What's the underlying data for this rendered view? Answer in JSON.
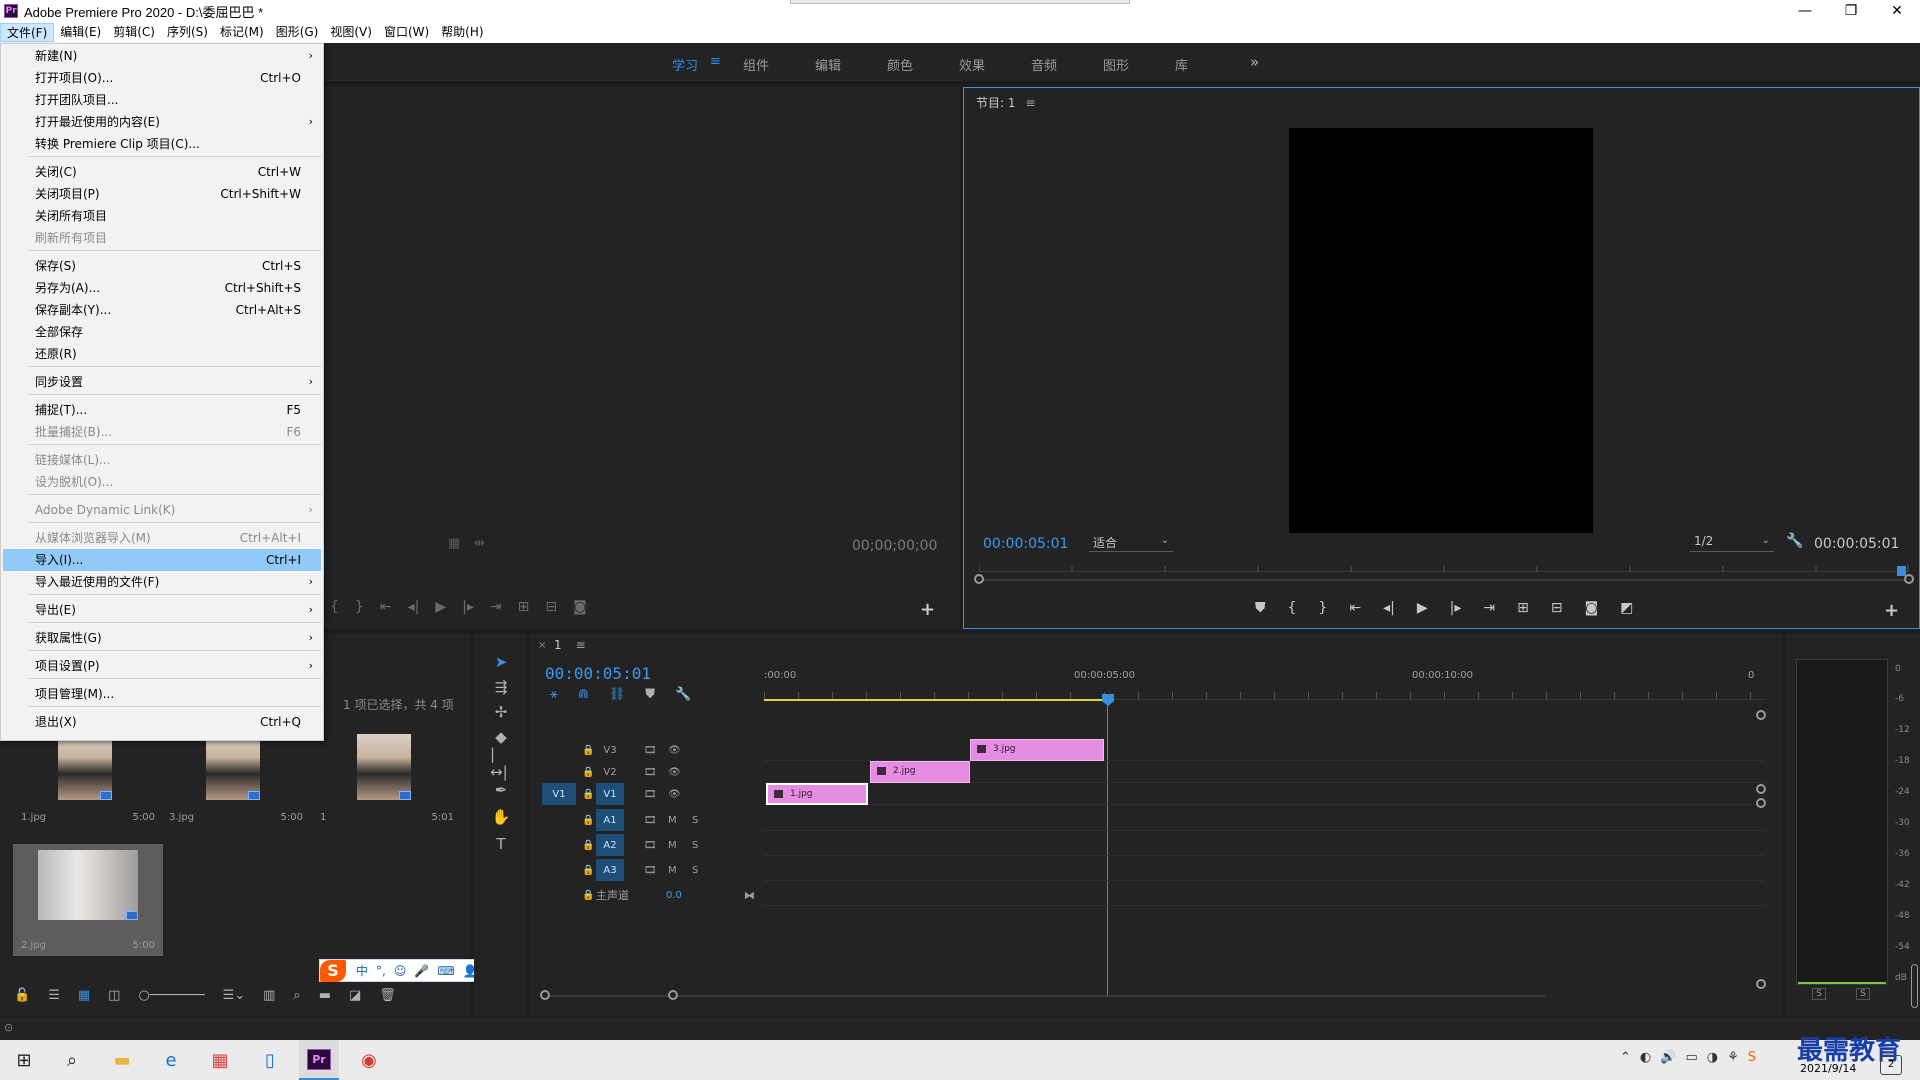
{
  "window": {
    "title": "Adobe Premiere Pro 2020 - D:\\委屈巴巴 *",
    "logo": "Pr",
    "controls": {
      "minimize": "—",
      "restore": "❐",
      "close": "✕"
    }
  },
  "menubar": [
    "文件(F)",
    "编辑(E)",
    "剪辑(C)",
    "序列(S)",
    "标记(M)",
    "图形(G)",
    "视图(V)",
    "窗口(W)",
    "帮助(H)"
  ],
  "workspaces": {
    "tabs": [
      "学习",
      "组件",
      "编辑",
      "颜色",
      "效果",
      "音频",
      "图形",
      "库"
    ],
    "active": "学习",
    "menu_icon": "≡",
    "more_icon": "»"
  },
  "file_menu": {
    "items": [
      {
        "label": "新建(N)",
        "shortcut": "",
        "submenu": true,
        "disabled": false
      },
      {
        "label": "打开项目(O)...",
        "shortcut": "Ctrl+O",
        "submenu": false,
        "disabled": false
      },
      {
        "label": "打开团队项目...",
        "shortcut": "",
        "submenu": false,
        "disabled": false
      },
      {
        "label": "打开最近使用的内容(E)",
        "shortcut": "",
        "submenu": true,
        "disabled": false
      },
      {
        "label": "转换 Premiere Clip 项目(C)...",
        "shortcut": "",
        "submenu": false,
        "disabled": false
      },
      {
        "label": "关闭(C)",
        "shortcut": "Ctrl+W",
        "submenu": false,
        "disabled": false
      },
      {
        "label": "关闭项目(P)",
        "shortcut": "Ctrl+Shift+W",
        "submenu": false,
        "disabled": false
      },
      {
        "label": "关闭所有项目",
        "shortcut": "",
        "submenu": false,
        "disabled": false
      },
      {
        "label": "刷新所有项目",
        "shortcut": "",
        "submenu": false,
        "disabled": true
      },
      {
        "label": "保存(S)",
        "shortcut": "Ctrl+S",
        "submenu": false,
        "disabled": false
      },
      {
        "label": "另存为(A)...",
        "shortcut": "Ctrl+Shift+S",
        "submenu": false,
        "disabled": false
      },
      {
        "label": "保存副本(Y)...",
        "shortcut": "Ctrl+Alt+S",
        "submenu": false,
        "disabled": false
      },
      {
        "label": "全部保存",
        "shortcut": "",
        "submenu": false,
        "disabled": false
      },
      {
        "label": "还原(R)",
        "shortcut": "",
        "submenu": false,
        "disabled": false
      },
      {
        "label": "同步设置",
        "shortcut": "",
        "submenu": true,
        "disabled": false
      },
      {
        "label": "捕捉(T)...",
        "shortcut": "F5",
        "submenu": false,
        "disabled": false
      },
      {
        "label": "批量捕捉(B)...",
        "shortcut": "F6",
        "submenu": false,
        "disabled": true
      },
      {
        "label": "链接媒体(L)...",
        "shortcut": "",
        "submenu": false,
        "disabled": true
      },
      {
        "label": "设为脱机(O)...",
        "shortcut": "",
        "submenu": false,
        "disabled": true
      },
      {
        "label": "Adobe Dynamic Link(K)",
        "shortcut": "",
        "submenu": true,
        "disabled": true
      },
      {
        "label": "从媒体浏览器导入(M)",
        "shortcut": "Ctrl+Alt+I",
        "submenu": false,
        "disabled": true
      },
      {
        "label": "导入(I)...",
        "shortcut": "Ctrl+I",
        "submenu": false,
        "disabled": false,
        "highlighted": true
      },
      {
        "label": "导入最近使用的文件(F)",
        "shortcut": "",
        "submenu": true,
        "disabled": false
      },
      {
        "label": "导出(E)",
        "shortcut": "",
        "submenu": true,
        "disabled": false
      },
      {
        "label": "获取属性(G)",
        "shortcut": "",
        "submenu": true,
        "disabled": false
      },
      {
        "label": "项目设置(P)",
        "shortcut": "",
        "submenu": true,
        "disabled": false
      },
      {
        "label": "项目管理(M)...",
        "shortcut": "",
        "submenu": false,
        "disabled": false
      },
      {
        "label": "退出(X)",
        "shortcut": "Ctrl+Q",
        "submenu": false,
        "disabled": false
      }
    ]
  },
  "source_monitor": {
    "timecode": "00;00;00;00"
  },
  "program_monitor": {
    "title": "节目: 1",
    "menu_icon": "≡",
    "timecode_left": "00:00:05:01",
    "fit": "适合",
    "resolution": "1/2",
    "timecode_right": "00:00:05:01",
    "add_icon": "+"
  },
  "project": {
    "status": "1 项已选择，共 4 项",
    "items": [
      {
        "name": "1.jpg",
        "duration": "5:00",
        "selected": false
      },
      {
        "name": "3.jpg",
        "duration": "5:00",
        "selected": false
      },
      {
        "name": "1",
        "duration": "5:01",
        "selected": false
      },
      {
        "name": "2.jpg",
        "duration": "5:00",
        "selected": true
      }
    ]
  },
  "ime": {
    "logo": "S",
    "mode": "中",
    "punct": "°,",
    "icons": [
      "☺",
      "🎤",
      "⌨",
      "👤",
      "👕",
      "▦"
    ]
  },
  "timeline": {
    "sequence_name": "1",
    "close_icon": "×",
    "menu_icon": "≡",
    "timecode": "00:00:05:01",
    "ruler_labels": [
      ":00:00",
      "00:00:05:00",
      "00:00:10:00",
      "0"
    ],
    "video_tracks": [
      {
        "name": "V3",
        "patched": false
      },
      {
        "name": "V2",
        "patched": false
      },
      {
        "name": "V1",
        "patched": true,
        "source": "V1"
      }
    ],
    "audio_tracks": [
      {
        "name": "A1",
        "m": "M",
        "s": "S"
      },
      {
        "name": "A2",
        "m": "M",
        "s": "S"
      },
      {
        "name": "A3",
        "m": "M",
        "s": "S"
      }
    ],
    "master": {
      "label": "主声道",
      "value": "0.0"
    },
    "clips": [
      {
        "name": "3.jpg",
        "track": "V3"
      },
      {
        "name": "2.jpg",
        "track": "V2"
      },
      {
        "name": "1.jpg",
        "track": "V1"
      }
    ]
  },
  "audio_meter": {
    "db_labels": [
      "0",
      "-6",
      "-12",
      "-18",
      "-24",
      "-30",
      "-36",
      "-42",
      "-48",
      "-54",
      "dB"
    ],
    "solo_l": "S",
    "solo_r": "S",
    "level_color": "#7ec845"
  },
  "taskbar": {
    "date": "2021/9/14",
    "watermark": "最需教育",
    "notif": "2"
  },
  "colors": {
    "accent": "#3a8fdc",
    "clip": "#e48de3",
    "panel": "#232323",
    "menu_highlight": "#91c9f7"
  }
}
